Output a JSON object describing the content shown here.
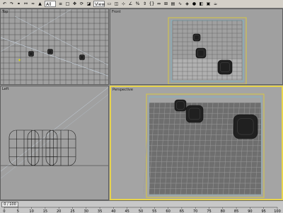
{
  "toolbar": {
    "selection_filter": "All",
    "buttons": [
      {
        "name": "undo-button",
        "glyph": "↶"
      },
      {
        "name": "redo-button",
        "glyph": "↷"
      },
      {
        "name": "link-button",
        "glyph": "⚭"
      },
      {
        "name": "unlink-button",
        "glyph": "⚯"
      },
      {
        "name": "bind-spacewarp-button",
        "glyph": "≈"
      },
      {
        "name": "select-object-button",
        "glyph": "▲"
      },
      {
        "name": "select-by-name-button",
        "glyph": "≡"
      },
      {
        "name": "select-region-button",
        "glyph": "□"
      },
      {
        "name": "select-move-button",
        "glyph": "✥"
      },
      {
        "name": "select-rotate-button",
        "glyph": "⟳"
      },
      {
        "name": "select-scale-button",
        "glyph": "◪"
      },
      {
        "name": "reference-coordinate-button",
        "glyph": "▭"
      },
      {
        "name": "pivot-button",
        "glyph": "◫"
      },
      {
        "name": "snap-toggle-button",
        "glyph": "⊹"
      },
      {
        "name": "angle-snap-button",
        "glyph": "∠"
      },
      {
        "name": "percent-snap-button",
        "glyph": "%"
      },
      {
        "name": "spinner-snap-button",
        "glyph": "⇕"
      },
      {
        "name": "named-selection-button",
        "glyph": "{}"
      },
      {
        "name": "mirror-button",
        "glyph": "⇔"
      },
      {
        "name": "align-button",
        "glyph": "⊞"
      },
      {
        "name": "layer-manager-button",
        "glyph": "▤"
      },
      {
        "name": "curve-editor-button",
        "glyph": "∿"
      },
      {
        "name": "schematic-view-button",
        "glyph": "◈"
      },
      {
        "name": "material-editor-button",
        "glyph": "●"
      },
      {
        "name": "render-setup-button",
        "glyph": "◧"
      },
      {
        "name": "render-frame-button",
        "glyph": "▣"
      },
      {
        "name": "quick-render-button",
        "glyph": "☕"
      }
    ],
    "view_filter": "View"
  },
  "viewports": {
    "top_label": "Top",
    "front_label": "Front",
    "left_label": "Left",
    "perspective_label": "Perspective",
    "colors": {
      "grid": "#5a5a5a",
      "background": "#a0a0a0",
      "active_border": "#e8d44d",
      "safe_frame": "#d8c840"
    }
  },
  "timeline": {
    "slider_text": "0 / 100",
    "ticks": [
      "0",
      "5",
      "10",
      "15",
      "20",
      "25",
      "30",
      "35",
      "40",
      "45",
      "50",
      "55",
      "60",
      "65",
      "70",
      "75",
      "80",
      "85",
      "90",
      "95",
      "100"
    ]
  }
}
